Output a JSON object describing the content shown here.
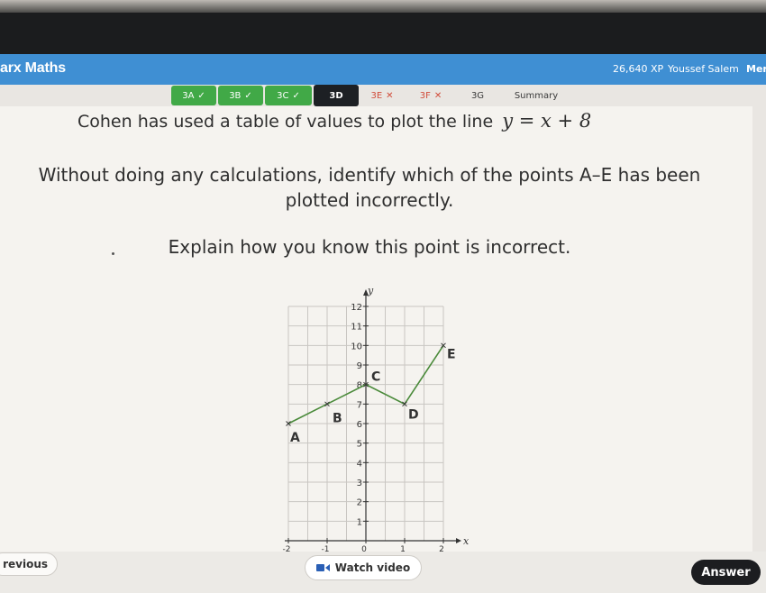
{
  "app": {
    "brand": "arx Maths",
    "xp": "26,640 XP",
    "user": "Youssef Salem",
    "menu_label": "Mer"
  },
  "tabs": [
    {
      "label": "3A",
      "mark": "✓",
      "state": "done"
    },
    {
      "label": "3B",
      "mark": "✓",
      "state": "done"
    },
    {
      "label": "3C",
      "mark": "✓",
      "state": "done"
    },
    {
      "label": "3D",
      "mark": "",
      "state": "current"
    },
    {
      "label": "3E",
      "mark": "✕",
      "state": "wrong"
    },
    {
      "label": "3F",
      "mark": "✕",
      "state": "wrong"
    },
    {
      "label": "3G",
      "mark": "",
      "state": "plain"
    },
    {
      "label": "Summary",
      "mark": "",
      "state": "plain"
    }
  ],
  "question": {
    "intro": "Cohen has used a table of values to plot the line",
    "equation": "y = x + 8",
    "instruction": "Without doing any calculations, identify which of the points A–E has been plotted incorrectly.",
    "explain": "Explain how you know this point is incorrect."
  },
  "graph": {
    "x_axis_label": "x",
    "y_axis_label": "y",
    "x_tick_labels": [
      "-2",
      "-1",
      "0",
      "1",
      "2"
    ],
    "y_tick_labels": [
      "1",
      "2",
      "3",
      "4",
      "5",
      "6",
      "7",
      "8",
      "9",
      "10",
      "11",
      "12"
    ],
    "points": [
      {
        "label": "A",
        "x": -2,
        "y": 6
      },
      {
        "label": "B",
        "x": -1,
        "y": 7
      },
      {
        "label": "C",
        "x": 0,
        "y": 8
      },
      {
        "label": "D",
        "x": 1,
        "y": 7
      },
      {
        "label": "E",
        "x": 2,
        "y": 10
      }
    ],
    "x_range": [
      -2,
      2
    ],
    "y_range": [
      0,
      12
    ],
    "line_color": "#4a8a3a",
    "grid": true
  },
  "footer": {
    "previous_label": "revious",
    "watch_video_label": "Watch video",
    "answer_label": "Answer"
  },
  "colors": {
    "header": "#3f8fd3",
    "tab_done": "#41a947",
    "tab_current": "#1d2024",
    "tab_wrong": "#d14c3a",
    "answer_button": "#1c1d20"
  }
}
